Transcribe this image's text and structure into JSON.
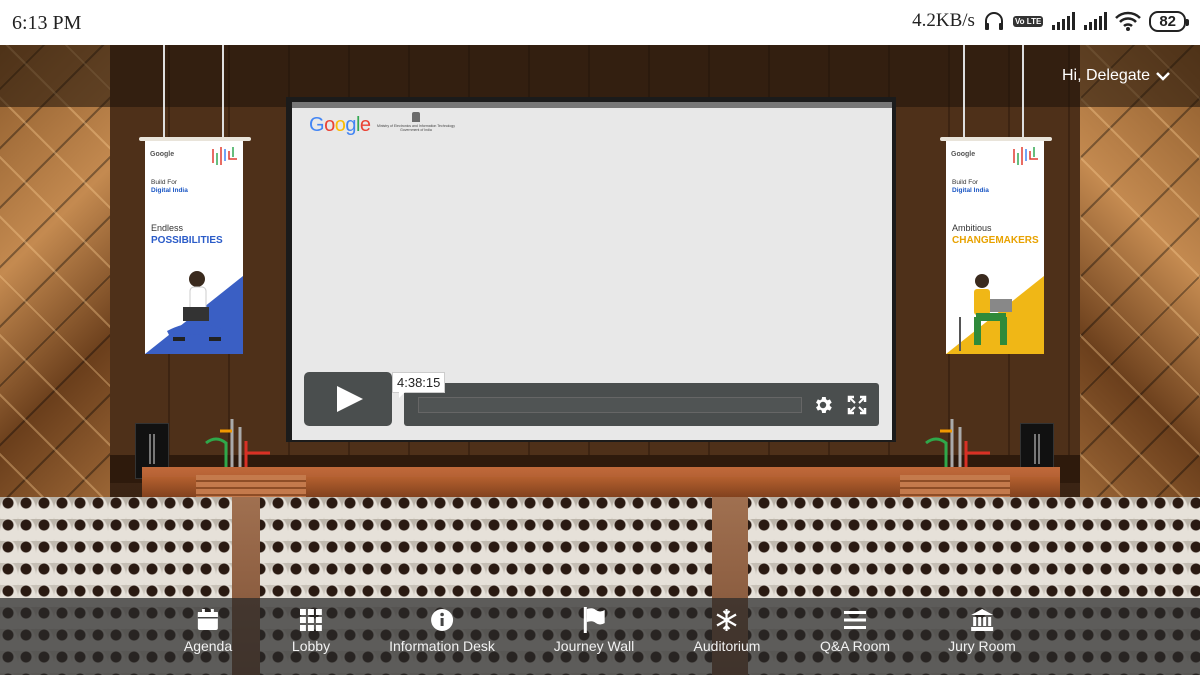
{
  "status_bar": {
    "time": "6:13 PM",
    "network_speed": "4.2KB/s",
    "volte": "Vo LTE",
    "battery": "82",
    "icons": [
      "headphones-icon",
      "volte-icon",
      "signal-icon",
      "signal-icon",
      "wifi-icon",
      "battery-icon"
    ]
  },
  "header": {
    "greeting": "Hi, Delegate"
  },
  "screen": {
    "logo": "Google",
    "ministry": "Ministry of Electronics and Information Technology Government of India",
    "timecode": "4:38:15",
    "progress_fraction": 0.0
  },
  "banners": {
    "left": {
      "google": "Google",
      "build_line1": "Build For",
      "build_line2": "Digital India",
      "line1": "Endless",
      "line2": "POSSIBILITIES",
      "accent": "#3a5fc4"
    },
    "right": {
      "google": "Google",
      "build_line1": "Build For",
      "build_line2": "Digital India",
      "line1": "Ambitious",
      "line2": "CHANGEMAKERS",
      "accent": "#f0b716"
    }
  },
  "bottom_nav": {
    "items": [
      {
        "label": "Agenda",
        "icon": "calendar-icon"
      },
      {
        "label": "Lobby",
        "icon": "grid-icon"
      },
      {
        "label": "Information Desk",
        "icon": "info-icon"
      },
      {
        "label": "Journey Wall",
        "icon": "flag-icon"
      },
      {
        "label": "Auditorium",
        "icon": "snowflake-icon"
      },
      {
        "label": "Q&A Room",
        "icon": "menu-icon"
      },
      {
        "label": "Jury Room",
        "icon": "bank-icon"
      }
    ]
  }
}
